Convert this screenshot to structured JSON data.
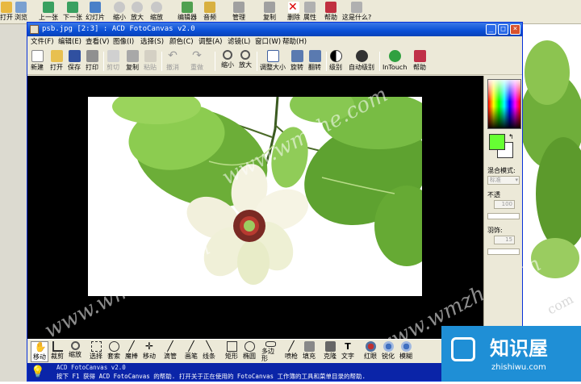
{
  "background_app": {
    "buttons": [
      "打开",
      "浏览",
      "上一张",
      "下一张",
      "幻灯片",
      "缩小",
      "放大",
      "缩放",
      "编辑器",
      "音频",
      "帮助",
      "这是什么?"
    ],
    "partial_buttons": [
      "管理",
      "剪切",
      "复制",
      "删除",
      "属性"
    ]
  },
  "window": {
    "title": "psb.jpg [2:3] : ACD FotoCanvas v2.0",
    "controls": [
      "_",
      "□",
      "×"
    ]
  },
  "menubar": [
    "文件(F)",
    "编辑(E)",
    "查看(V)",
    "图像(I)",
    "选择(S)",
    "颜色(C)",
    "调整(A)",
    "滤镜(L)",
    "窗口(W)",
    "帮助(H)"
  ],
  "toolbar": [
    {
      "label": "新建",
      "enabled": true
    },
    {
      "label": "打开",
      "enabled": true
    },
    {
      "label": "保存",
      "enabled": true
    },
    {
      "label": "打印",
      "enabled": true
    },
    {
      "label": "剪切",
      "enabled": false
    },
    {
      "label": "复制",
      "enabled": true
    },
    {
      "label": "粘贴",
      "enabled": false
    },
    {
      "label": "撤消",
      "enabled": false
    },
    {
      "label": "重做",
      "enabled": false
    },
    {
      "label": "缩小",
      "enabled": true
    },
    {
      "label": "放大",
      "enabled": true
    },
    {
      "label": "调整大小",
      "enabled": true
    },
    {
      "label": "旋转",
      "enabled": true
    },
    {
      "label": "翻转",
      "enabled": true
    },
    {
      "label": "级别",
      "enabled": true
    },
    {
      "label": "自动级别",
      "enabled": true
    },
    {
      "label": "InTouch",
      "enabled": true
    },
    {
      "label": "帮助",
      "enabled": true
    }
  ],
  "right_panel": {
    "blend_label": "混合模式:",
    "blend_value": "标准",
    "opacity_label": "不透",
    "opacity_value": "100",
    "feather_label": "羽饰:",
    "feather_value": "15"
  },
  "bottom_tools": [
    "移动",
    "裁剪",
    "缩放",
    "选择",
    "套索",
    "魔棒",
    "移动",
    "滴管",
    "画笔",
    "线条",
    "矩形",
    "椭圆",
    "多边形",
    "喷枪",
    "填充",
    "克隆",
    "文字",
    "红眼",
    "锐化",
    "模糊"
  ],
  "status": {
    "line1": "ACD FotoCanvas v2.0",
    "line2": "按下 F1 获得 ACD FotoCanvas 的帮助. 打开关于正在使用的 FotoCanvas 工作簿的工具和菜单目录的帮助."
  },
  "watermark": {
    "text": "www.wmzhe.com",
    "brand_cn": "知识屋",
    "brand_url": "zhishiwu.com"
  },
  "colors": {
    "titlebar": "#0a4fd6",
    "statusbar": "#0a24a8",
    "foreground": "#66ff33",
    "background": "#ffffff",
    "brand": "#1f8fd6"
  }
}
